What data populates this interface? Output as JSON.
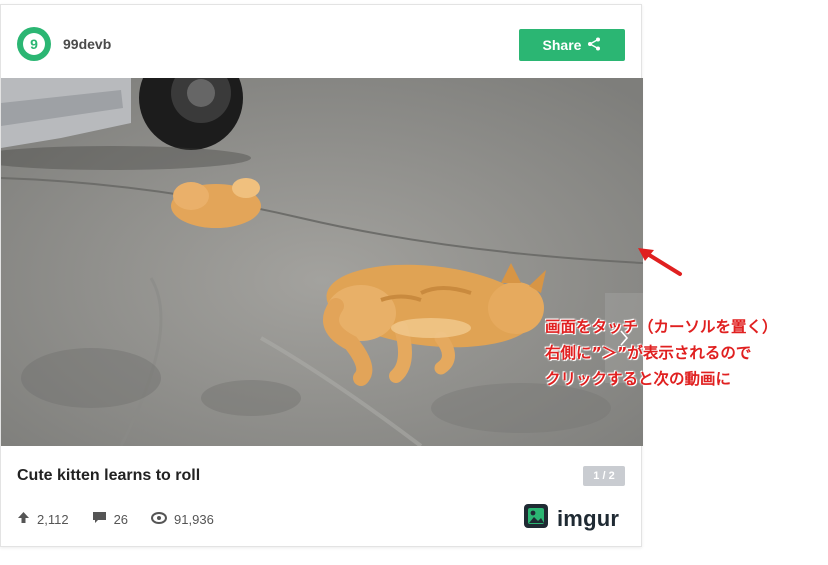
{
  "post": {
    "username": "99devb",
    "avatar_letter": "9",
    "share_label": "Share",
    "title": "Cute kitten learns to roll",
    "pager": "1 / 2"
  },
  "stats": {
    "upvotes": "2,112",
    "comments": "26",
    "views": "91,936"
  },
  "brand": {
    "name": "imgur",
    "accent_color": "#2bb673"
  },
  "annotation": {
    "lines": [
      "画面をタッチ（カーソルを置く）",
      "右側に”＞”が表示されるので",
      "クリックすると次の動画に"
    ],
    "color": "#e02020"
  },
  "icons": [
    "share-icon",
    "upvote-icon",
    "comment-icon",
    "eye-icon",
    "chevron-right-icon",
    "imgur-logo-icon",
    "red-arrow-icon"
  ]
}
